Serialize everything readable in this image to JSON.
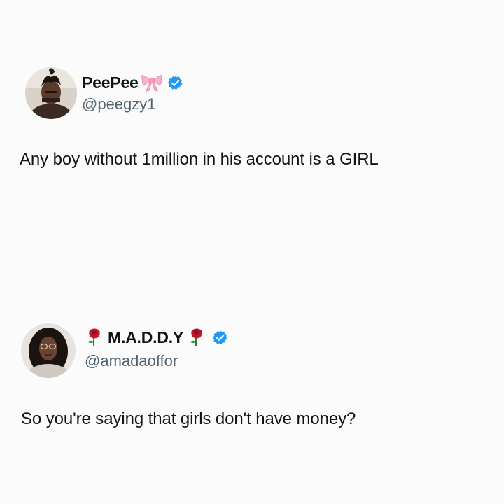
{
  "tweets": [
    {
      "display_name": "PeePee",
      "name_emoji_after": "bow-emoji",
      "verified": true,
      "handle": "@peegzy1",
      "text": "Any boy without 1million in his account is a GIRL"
    },
    {
      "display_name": "M.A.D.D.Y",
      "name_emoji_before": "rose-emoji",
      "name_emoji_after": "rose-emoji",
      "verified": true,
      "handle": "@amadaoffor",
      "text": "So you're saying that girls don't have money?"
    }
  ],
  "colors": {
    "background": "#fbfbfb",
    "text": "#0f1419",
    "handle": "#536471",
    "verified_badge": "#1d9bf0"
  }
}
